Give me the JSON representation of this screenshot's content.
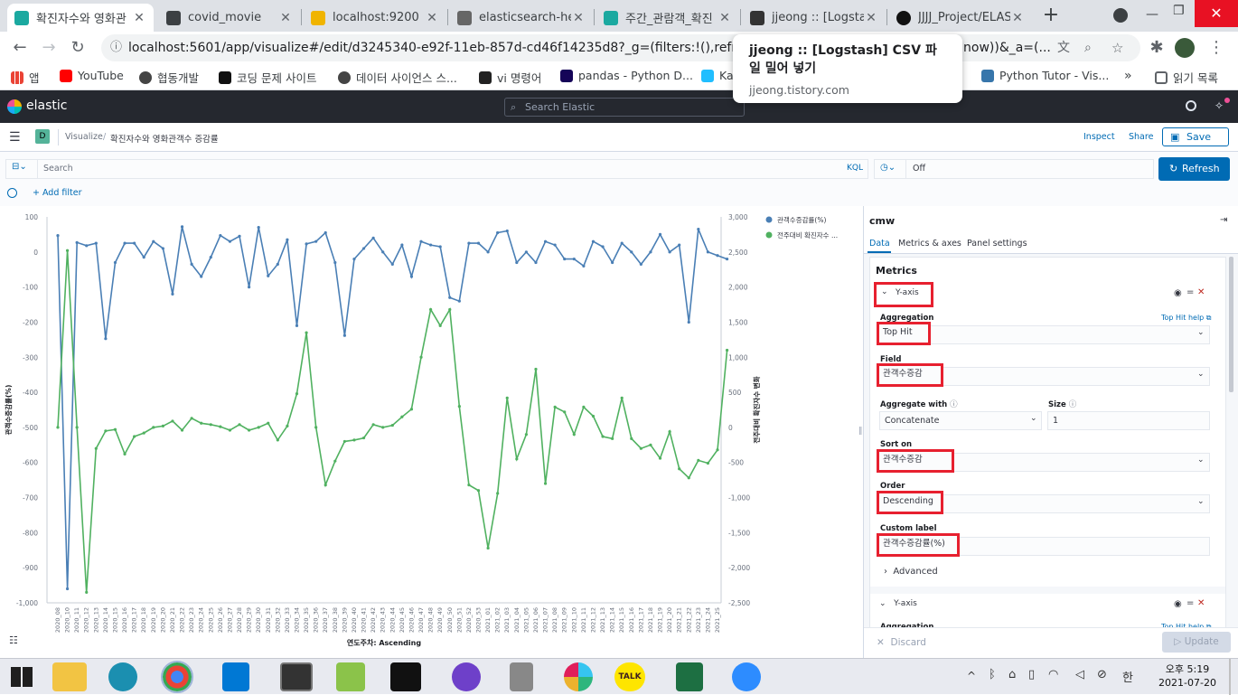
{
  "browser": {
    "tabs": [
      {
        "title": "확진자수와 영화관",
        "color": "#1ba9a0"
      },
      {
        "title": "covid_movie",
        "color": "#3c4043"
      },
      {
        "title": "localhost:9200",
        "color": "#f0b400"
      },
      {
        "title": "elasticsearch-head",
        "color": "#555"
      },
      {
        "title": "주간_관람객_확진",
        "color": "#1ba9a0"
      },
      {
        "title": "jjeong :: [Logstash",
        "color": "#333"
      },
      {
        "title": "JJJJ_Project/ELAST",
        "color": "#111"
      }
    ],
    "new_tab": "+",
    "url": "localhost:5601/app/visualize#/edit/d3245340-e92f-11eb-857d-cd46f14235d8?_g=(filters:!(),refreshInterval:",
    "url_tail": "now))&_a=(...",
    "bookmarks": [
      "앱",
      "YouTube",
      "협동개발",
      "코딩 문제 사이트",
      "데이터 사이언스 스...",
      "vi 명령어",
      "pandas - Python D...",
      "Ka",
      "Python Tutor - Vis...",
      "읽기 목록"
    ],
    "tooltip": {
      "title": "jjeong :: [Logstash] CSV 파일 밀어 넣기",
      "url": "jjeong.tistory.com"
    }
  },
  "kibana": {
    "logo_text": "elastic",
    "search_placeholder": "Search Elastic",
    "space_badge": "D",
    "breadcrumb": [
      "Visualize",
      "확진자수와 영화관객수 증감률"
    ],
    "actions": {
      "inspect": "Inspect",
      "share": "Share",
      "save": "Save"
    },
    "query_placeholder": "Search",
    "kql": "KQL",
    "time_value": "Off",
    "refresh": "Refresh",
    "add_filter": "+ Add filter"
  },
  "chart_data": {
    "type": "line",
    "x": [
      "2020_08",
      "2020_10",
      "2020_11",
      "2020_12",
      "2020_13",
      "2020_14",
      "2020_15",
      "2020_16",
      "2020_17",
      "2020_18",
      "2020_19",
      "2020_20",
      "2020_21",
      "2020_22",
      "2020_23",
      "2020_24",
      "2020_25",
      "2020_26",
      "2020_27",
      "2020_28",
      "2020_29",
      "2020_30",
      "2020_31",
      "2020_32",
      "2020_33",
      "2020_34",
      "2020_35",
      "2020_36",
      "2020_37",
      "2020_38",
      "2020_39",
      "2020_40",
      "2020_41",
      "2020_42",
      "2020_43",
      "2020_44",
      "2020_45",
      "2020_46",
      "2020_47",
      "2020_48",
      "2020_49",
      "2020_50",
      "2020_51",
      "2020_52",
      "2020_53",
      "2021_01",
      "2021_02",
      "2021_03",
      "2021_04",
      "2021_05",
      "2021_06",
      "2021_07",
      "2021_08",
      "2021_09",
      "2021_10",
      "2021_11",
      "2021_12",
      "2021_13",
      "2021_14",
      "2021_15",
      "2021_16",
      "2021_17",
      "2021_18",
      "2021_19",
      "2021_20",
      "2021_21",
      "2021_22",
      "2021_23",
      "2021_24",
      "2021_25"
    ],
    "xlabel": "연도주차: Ascending",
    "ylabel_left": "관객수증감률(%)",
    "ylabel_right": "전주대비 확진자수 변화",
    "yticks_left": [
      "100",
      "0",
      "-100",
      "-200",
      "-300",
      "-400",
      "-500",
      "-600",
      "-700",
      "-800",
      "-900",
      "-1,000"
    ],
    "yticks_right": [
      "3,000",
      "2,500",
      "2,000",
      "1,500",
      "1,000",
      "500",
      "0",
      "-500",
      "-1,000",
      "-1,500",
      "-2,000",
      "-2,500"
    ],
    "ylim_left": [
      -1000,
      100
    ],
    "ylim_right": [
      -2500,
      3000
    ],
    "series": [
      {
        "name": "관객수증감률(%)",
        "color": "#4a7fb5",
        "axis": "left",
        "values": [
          47,
          -960,
          27,
          18,
          25,
          -247,
          -30,
          25,
          25,
          -15,
          30,
          10,
          -120,
          72,
          -35,
          -70,
          -15,
          47,
          30,
          45,
          -100,
          70,
          -68,
          -35,
          35,
          -210,
          23,
          30,
          55,
          -30,
          -238,
          -20,
          10,
          40,
          0,
          -35,
          20,
          -70,
          30,
          20,
          15,
          -130,
          -140,
          25,
          25,
          0,
          55,
          60,
          -30,
          0,
          -30,
          30,
          20,
          -20,
          -20,
          -40,
          30,
          15,
          -30,
          25,
          0,
          -35,
          0,
          50,
          0,
          20,
          -200,
          65,
          0,
          -10,
          -20
        ]
      },
      {
        "name": "전주대비 확진자수 ...",
        "color": "#50b160",
        "axis": "right",
        "values": [
          0,
          2520,
          0,
          -2350,
          -300,
          -50,
          -30,
          -380,
          -130,
          -80,
          0,
          20,
          90,
          -40,
          130,
          60,
          40,
          10,
          -40,
          40,
          -40,
          0,
          60,
          -180,
          20,
          480,
          1350,
          0,
          -820,
          -480,
          -200,
          -180,
          -150,
          40,
          0,
          30,
          150,
          260,
          1000,
          1680,
          1450,
          1680,
          300,
          -820,
          -900,
          -1720,
          -940,
          420,
          -450,
          -100,
          830,
          -800,
          290,
          220,
          -100,
          290,
          160,
          -130,
          -160,
          420,
          -160,
          -300,
          -250,
          -440,
          -60,
          -590,
          -720,
          -470,
          -510,
          -320,
          1100
        ]
      }
    ]
  },
  "editor": {
    "index_name": "cmw",
    "tabs": [
      "Data",
      "Metrics & axes",
      "Panel settings"
    ],
    "section": "Metrics",
    "yaxis_label": "Y-axis",
    "aggregation_label": "Aggregation",
    "help_link": "Top Hit help",
    "aggregation_value": "Top Hit",
    "field_label": "Field",
    "field_value": "관객수증감",
    "aggregate_with_label": "Aggregate with",
    "aggregate_with_value": "Concatenate",
    "size_label": "Size",
    "size_value": "1",
    "sort_on_label": "Sort on",
    "sort_on_value": "관객수증감",
    "order_label": "Order",
    "order_value": "Descending",
    "custom_label_label": "Custom label",
    "custom_label_value": "관객수증감률(%)",
    "advanced": "Advanced",
    "yaxis2_label": "Y-axis",
    "aggregation2_label": "Aggregation",
    "help_link2": "Top Hit help",
    "discard": "Discard",
    "update": "Update"
  },
  "taskbar": {
    "time": "오후 5:19",
    "date": "2021-07-20",
    "lang": "한"
  }
}
